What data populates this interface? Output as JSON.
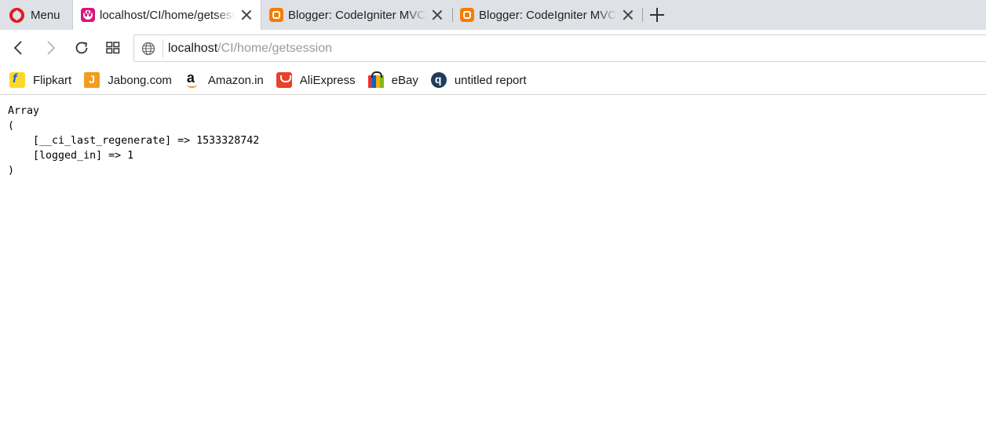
{
  "browser": {
    "menu_label": "Menu",
    "tabs": [
      {
        "title": "localhost/CI/home/getsession",
        "active": true,
        "favicon": "wamp-icon"
      },
      {
        "title": "Blogger: CodeIgniter MVC",
        "active": false,
        "favicon": "blogger-icon"
      },
      {
        "title": "Blogger: CodeIgniter MVC",
        "active": false,
        "favicon": "blogger-icon"
      }
    ],
    "new_tab_icon": "plus-icon"
  },
  "toolbar": {
    "back_icon": "back-arrow-icon",
    "forward_icon": "forward-arrow-icon",
    "reload_icon": "reload-icon",
    "tabs_grid_icon": "grid-icon",
    "address": {
      "host": "localhost",
      "path": "/CI/home/getsession",
      "site_info_icon": "globe-icon"
    }
  },
  "bookmarks": [
    {
      "label": "Flipkart",
      "icon": "flipkart-icon"
    },
    {
      "label": "Jabong.com",
      "icon": "jabong-icon"
    },
    {
      "label": "Amazon.in",
      "icon": "amazon-icon"
    },
    {
      "label": "AliExpress",
      "icon": "aliexpress-icon"
    },
    {
      "label": "eBay",
      "icon": "ebay-icon"
    },
    {
      "label": "untitled report",
      "icon": "report-icon"
    }
  ],
  "page": {
    "lines": [
      "Array",
      "(",
      "    [__ci_last_regenerate] => 1533328742",
      "    [logged_in] => 1",
      ")"
    ]
  },
  "colors": {
    "tabstrip_bg": "#dee1e6",
    "opera_red": "#e01b24",
    "wamp_pink": "#d6157d",
    "blogger_orange": "#f57d00"
  }
}
